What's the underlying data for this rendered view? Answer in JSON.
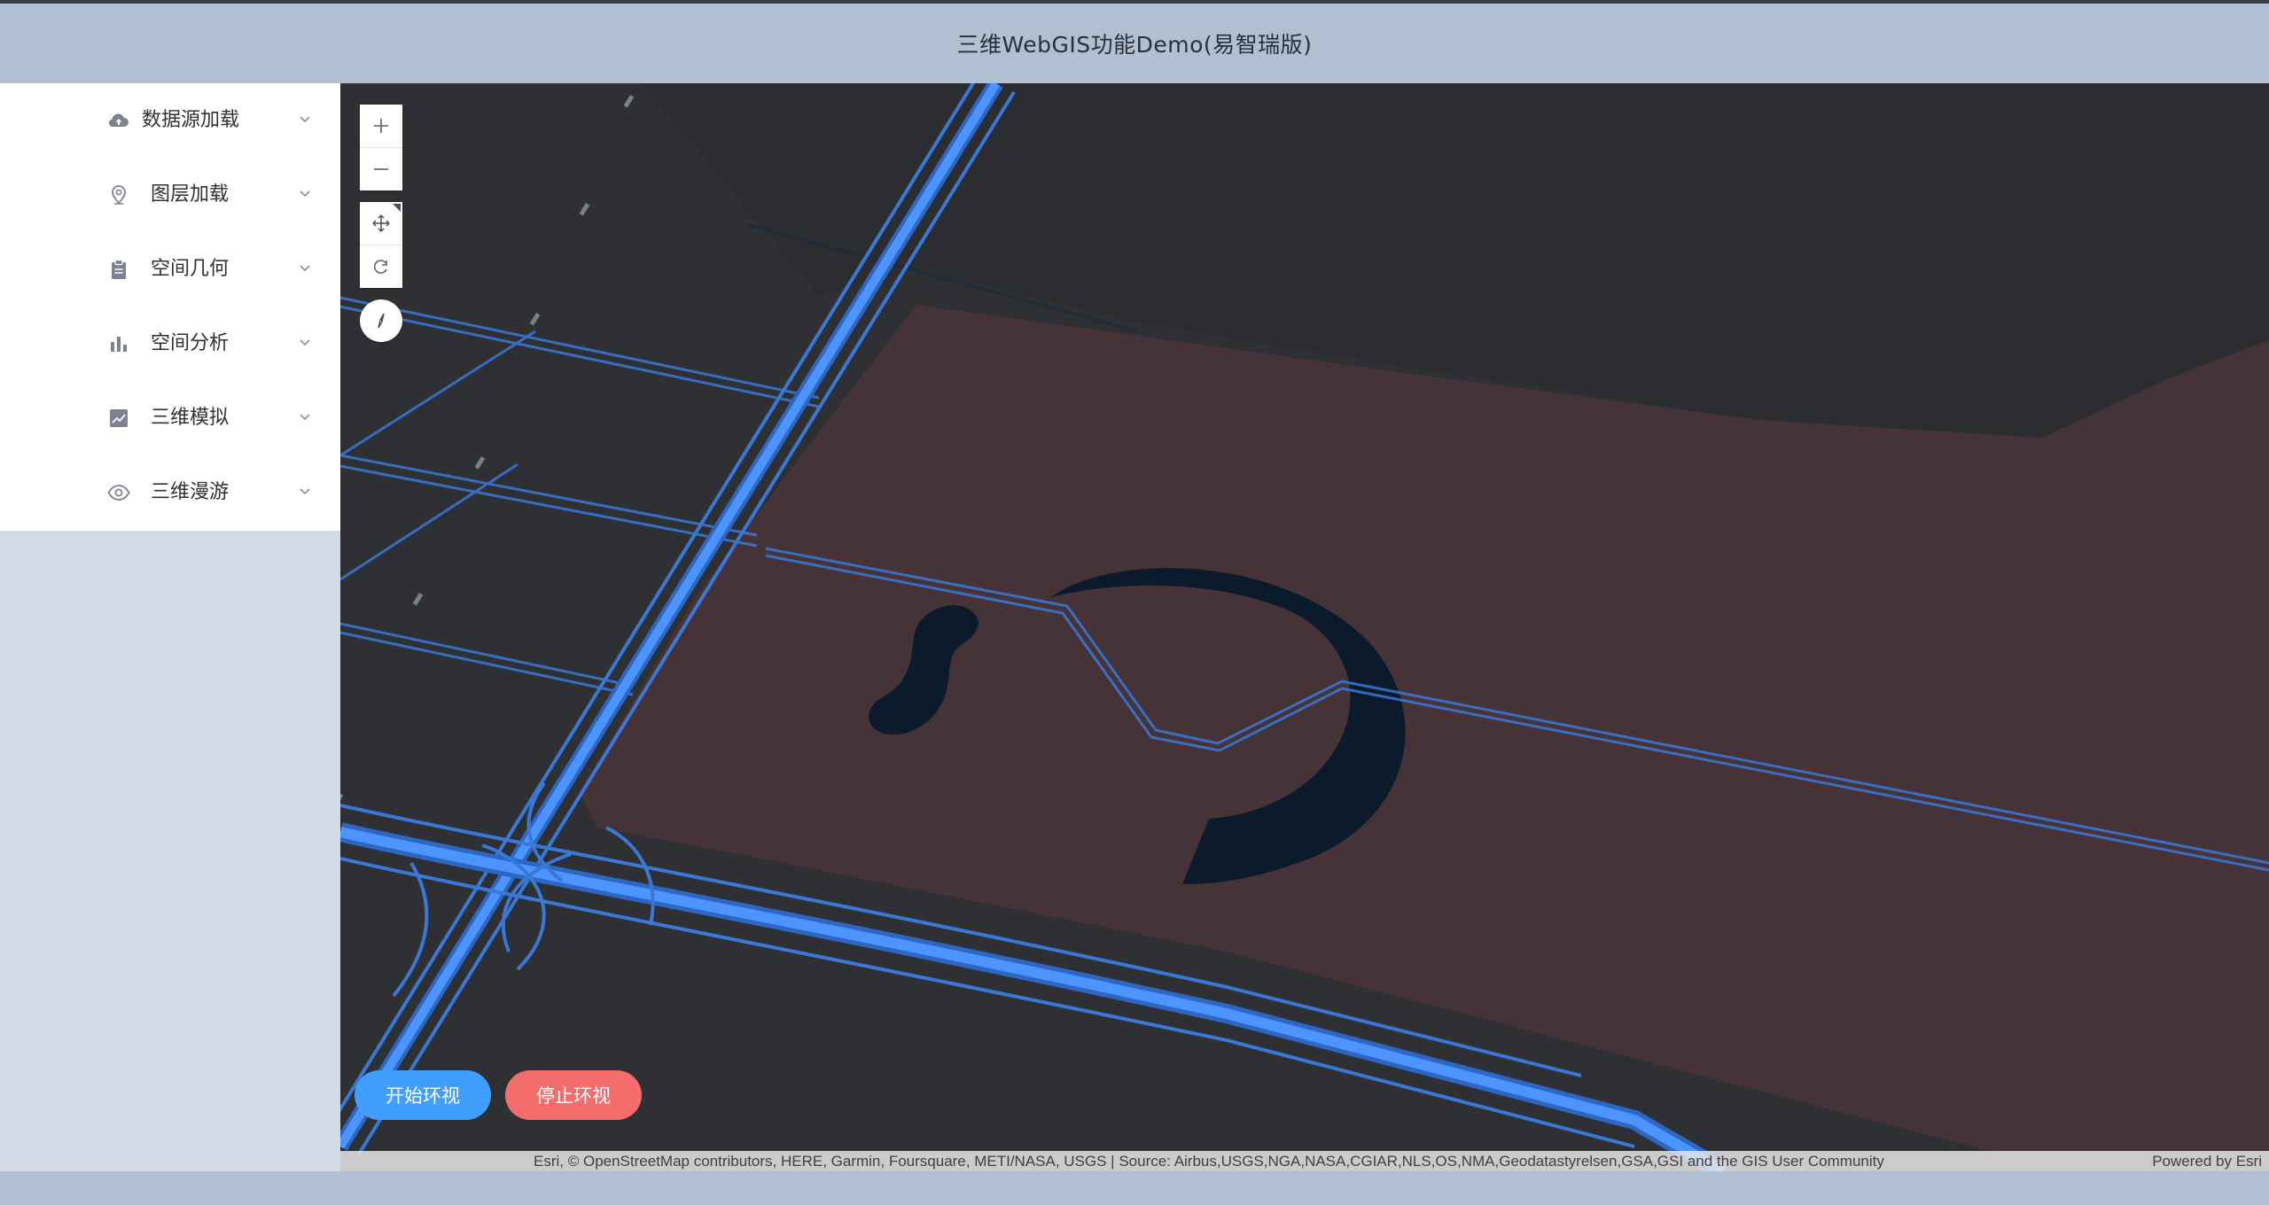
{
  "header": {
    "title": "三维WebGIS功能Demo(易智瑞版)"
  },
  "sidebar": {
    "items": [
      {
        "label": "数据源加载",
        "icon": "cloud-upload-icon"
      },
      {
        "label": "图层加载",
        "icon": "location-pin-icon"
      },
      {
        "label": "空间几何",
        "icon": "clipboard-icon"
      },
      {
        "label": "空间分析",
        "icon": "bar-chart-icon"
      },
      {
        "label": "三维模拟",
        "icon": "line-chart-icon"
      },
      {
        "label": "三维漫游",
        "icon": "eye-icon"
      }
    ]
  },
  "map": {
    "controls": {
      "zoom_in": "+",
      "zoom_out": "—",
      "pan": "pan-icon",
      "rotate": "rotate-icon",
      "compass": "compass-icon"
    },
    "colors": {
      "background": "#2e3033",
      "park": "#453338",
      "water": "#0b1b2b",
      "road": "#3a78d8"
    }
  },
  "actions": {
    "start_label": "开始环视",
    "stop_label": "停止环视",
    "start_color": "#409eff",
    "stop_color": "#f56c6c"
  },
  "attribution": {
    "text": "Esri, © OpenStreetMap contributors, HERE, Garmin, Foursquare, METI/NASA, USGS | Source: Airbus,USGS,NGA,NASA,CGIAR,NLS,OS,NMA,Geodatastyrelsen,GSA,GSI and the GIS User Community",
    "powered": "Powered by Esri"
  }
}
